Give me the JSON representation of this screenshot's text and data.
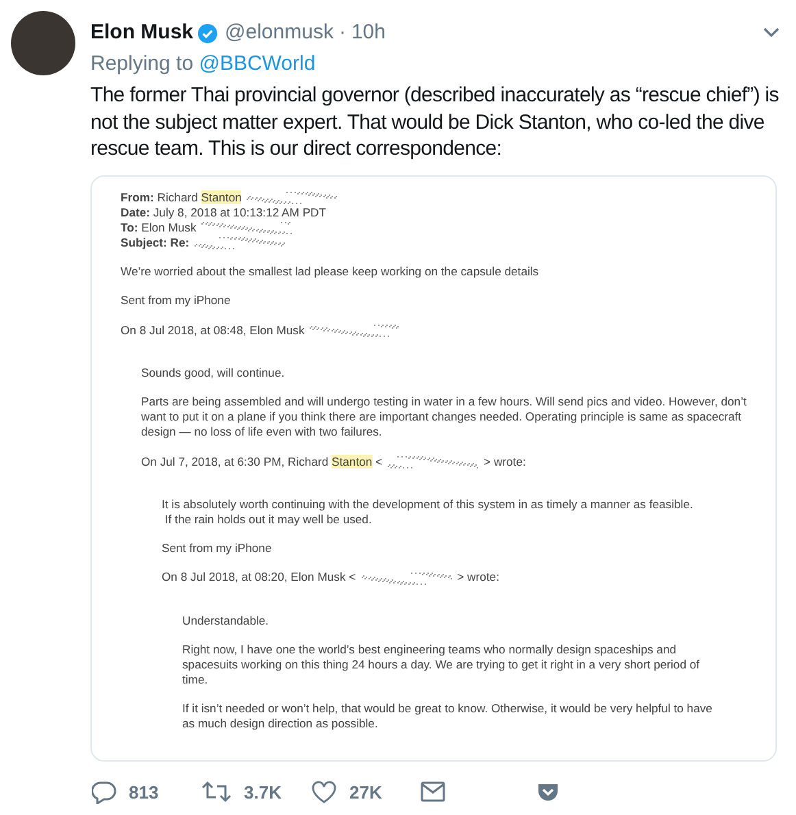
{
  "tweet": {
    "name": "Elon Musk",
    "verified": true,
    "handle": "@elonmusk",
    "separator": "·",
    "time": "10h",
    "replying_label": "Replying to",
    "replying_to": "@BBCWorld",
    "text": "The former Thai provincial governor (described inaccurately as “rescue chief”) is not the subject matter expert. That would be Dick Stanton, who co-led the dive rescue team. This is our direct correspondence:"
  },
  "email": {
    "blocks": [
      [
        [
          {
            "kind": "text",
            "text": "**From:** Richard ",
            "highlighted": false
          },
          {
            "kind": "text",
            "text": "Stanton",
            "highlighted": true
          },
          {
            "kind": "redaction"
          }
        ],
        [
          {
            "kind": "text",
            "text": "**Date:** July 8, 2018 at 10:13:12 AM PDT",
            "highlighted": false
          }
        ],
        [
          {
            "kind": "text",
            "text": "**To:** Elon Musk",
            "highlighted": false
          },
          {
            "kind": "redaction"
          }
        ],
        [
          {
            "kind": "text",
            "text": "**Subject: Re:**",
            "highlighted": false
          },
          {
            "kind": "redaction"
          }
        ]
      ],
      [
        [
          {
            "kind": "text",
            "text": "We’re worried about the smallest lad please keep working on the capsule details",
            "highlighted": false
          }
        ]
      ],
      [
        [
          {
            "kind": "text",
            "text": "Sent from my iPhone",
            "highlighted": false
          }
        ]
      ],
      [
        [
          {
            "kind": "text",
            "text": "On 8 Jul 2018, at 08:48, Elon Musk",
            "highlighted": false
          },
          {
            "kind": "redaction"
          }
        ]
      ]
    ],
    "quote": {
      "blocks": [
        [
          [
            {
              "kind": "text",
              "text": "Sounds good, will continue.",
              "highlighted": false
            }
          ]
        ],
        [
          [
            {
              "kind": "text",
              "text": "Parts are being assembled and will undergo testing in water in a few hours. Will send pics and video. However, don’t",
              "highlighted": false
            }
          ],
          [
            {
              "kind": "text",
              "text": "want to put it on a plane if you think there are important changes needed. Operating principle is same as spacecraft",
              "highlighted": false
            }
          ],
          [
            {
              "kind": "text",
              "text": "design — no loss of life even with two failures.",
              "highlighted": false
            }
          ]
        ],
        [
          [
            {
              "kind": "text",
              "text": "On Jul 7, 2018, at 6:30 PM, Richard ",
              "highlighted": false
            },
            {
              "kind": "text",
              "text": "Stanton",
              "highlighted": true
            },
            {
              "kind": "text",
              "text": " <",
              "highlighted": false
            },
            {
              "kind": "redaction"
            },
            {
              "kind": "text",
              "text": "> wrote:",
              "highlighted": false
            }
          ]
        ]
      ],
      "quote": {
        "blocks": [
          [
            [
              {
                "kind": "text",
                "text": "It is absolutely worth continuing with the development of this system in as timely a manner as feasible.",
                "highlighted": false
              }
            ],
            [
              {
                "kind": "text",
                "text": " If the rain holds out it may well be used.",
                "highlighted": false
              }
            ]
          ],
          [
            [
              {
                "kind": "text",
                "text": "Sent from my iPhone",
                "highlighted": false
              }
            ]
          ],
          [
            [
              {
                "kind": "text",
                "text": "On 8 Jul 2018, at 08:20, Elon Musk <",
                "highlighted": false
              },
              {
                "kind": "redaction"
              },
              {
                "kind": "text",
                "text": "> wrote:",
                "highlighted": false
              }
            ]
          ]
        ],
        "quote": {
          "blocks": [
            [
              [
                {
                  "kind": "text",
                  "text": "Understandable.",
                  "highlighted": false
                }
              ]
            ],
            [
              [
                {
                  "kind": "text",
                  "text": "Right now, I have one the world’s best engineering teams who normally design spaceships and",
                  "highlighted": false
                }
              ],
              [
                {
                  "kind": "text",
                  "text": "spacesuits working on this thing 24 hours a day. We are trying to get it right in a very short period of",
                  "highlighted": false
                }
              ],
              [
                {
                  "kind": "text",
                  "text": "time.",
                  "highlighted": false
                }
              ]
            ],
            [
              [
                {
                  "kind": "text",
                  "text": "If it isn’t needed or won’t help, that would be great to know. Otherwise, it would be very helpful to have",
                  "highlighted": false
                }
              ],
              [
                {
                  "kind": "text",
                  "text": "as much design direction as possible.",
                  "highlighted": false
                }
              ]
            ]
          ]
        }
      }
    }
  },
  "actions": [
    {
      "kind": "reply",
      "count": "813"
    },
    {
      "kind": "retweet",
      "count": "3.7K"
    },
    {
      "kind": "like",
      "count": "27K"
    },
    {
      "kind": "message"
    },
    {
      "kind": "pocket"
    }
  ]
}
